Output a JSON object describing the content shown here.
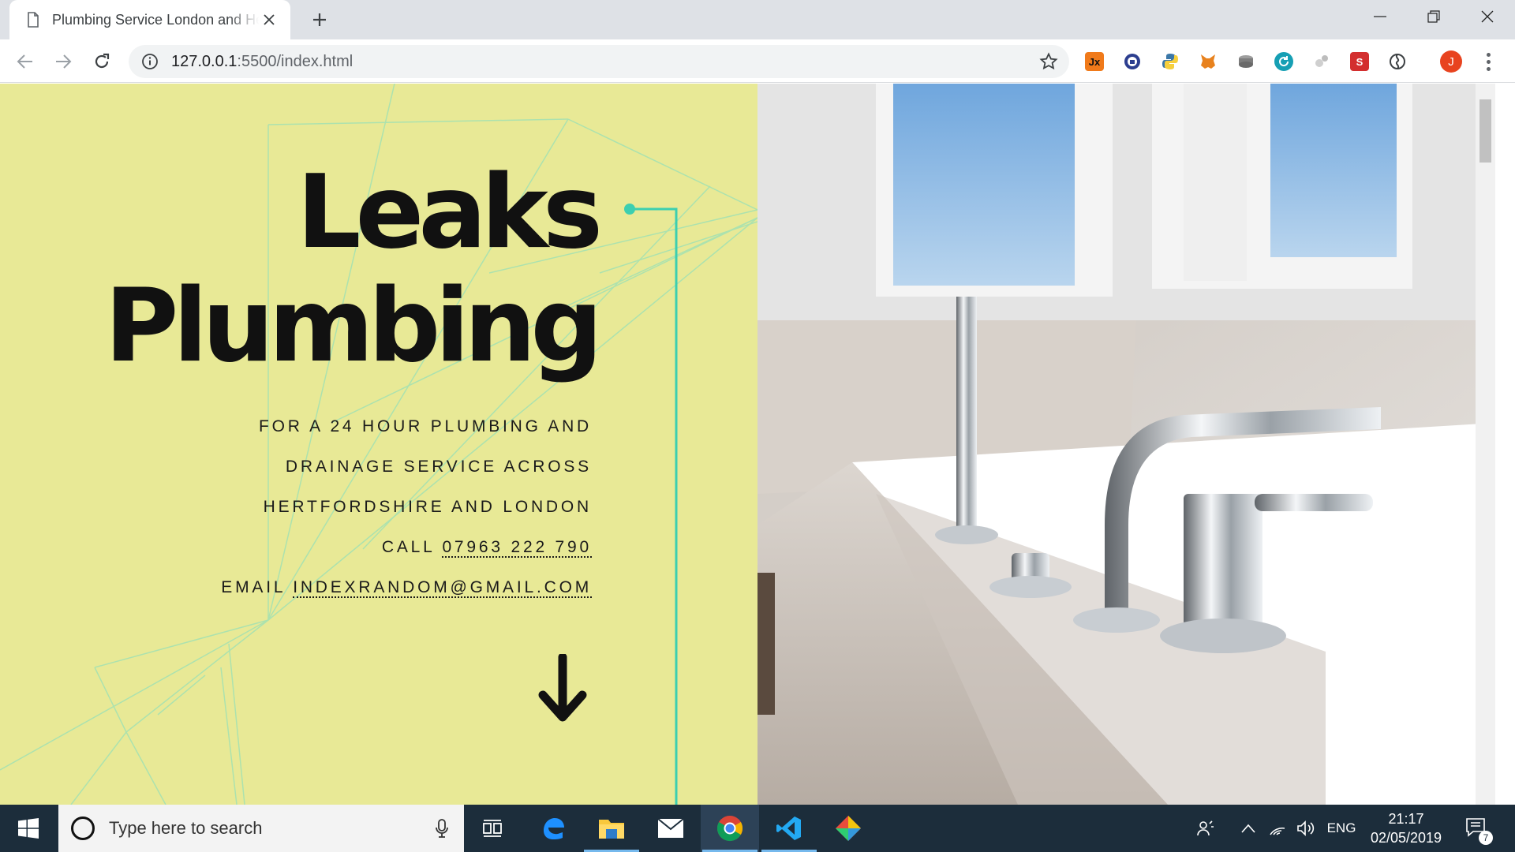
{
  "browser": {
    "tab_title": "Plumbing Service London and Hertfordshire",
    "url_host": "127.0.0.1",
    "url_rest": ":5500/index.html",
    "profile_initial": "J"
  },
  "page": {
    "title_line1": "Leaks",
    "title_line2": "Plumbing",
    "info_line1": "FOR A 24 HOUR PLUMBING AND",
    "info_line2": "DRAINAGE SERVICE ACROSS",
    "info_line3": "HERTFORDSHIRE AND LONDON",
    "call_label": "CALL",
    "phone": "07963 222 790",
    "email_label": "EMAIL",
    "email": "INDEXRANDOM@GMAIL.COM",
    "colors": {
      "panel": "#e8e996",
      "accent_line": "#3ccfb0",
      "text": "#111111"
    }
  },
  "taskbar": {
    "search_placeholder": "Type here to search",
    "language": "ENG",
    "time": "21:17",
    "date": "02/05/2019",
    "notification_count": "7"
  },
  "icons": {
    "extensions": [
      "jx-icon",
      "lock-extension-icon",
      "python-icon",
      "metamask-icon",
      "disk-icon",
      "refresh-extension-icon",
      "puzzle-icon",
      "red-extension-icon",
      "swirl-icon"
    ],
    "taskbar_apps": [
      "task-view-icon",
      "edge-icon",
      "file-explorer-icon",
      "mail-icon",
      "chrome-icon",
      "vscode-icon",
      "git-kraken-icon"
    ]
  }
}
